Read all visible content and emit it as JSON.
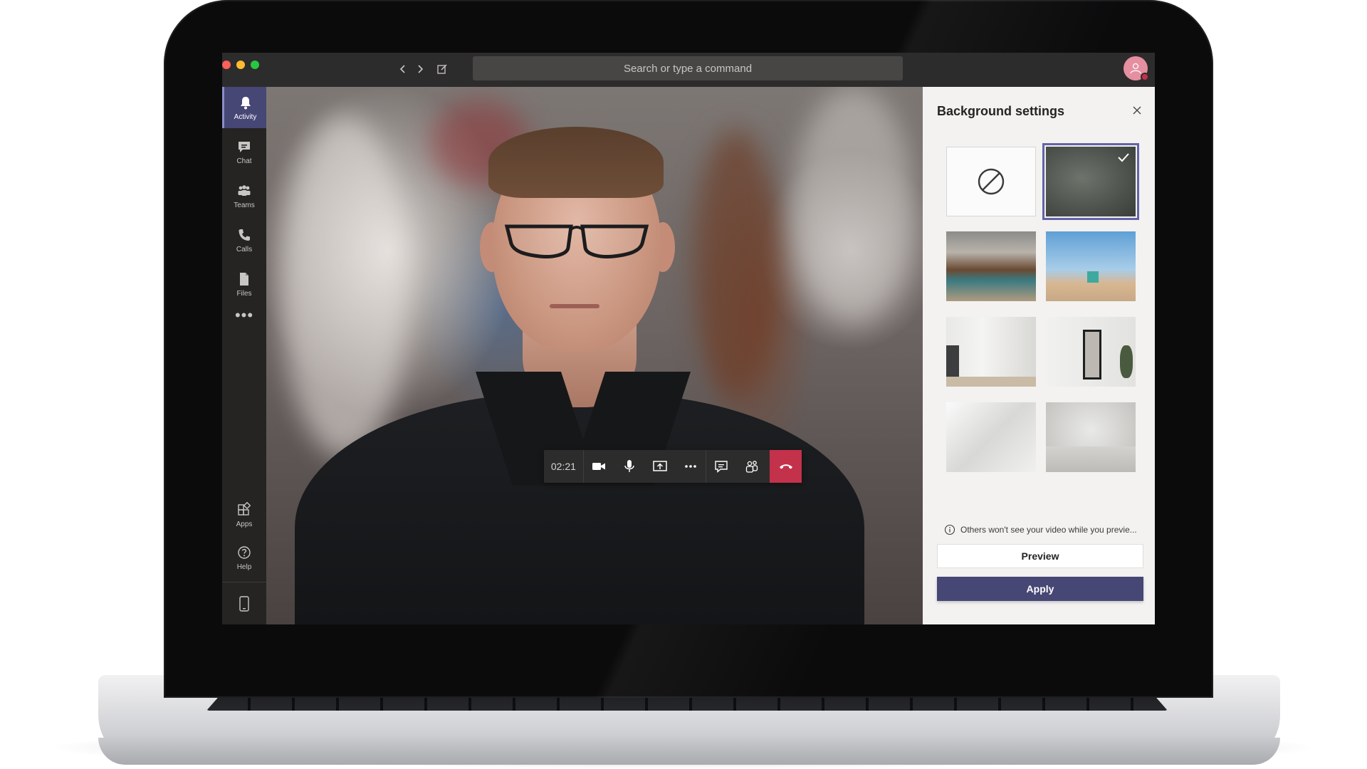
{
  "titlebar": {
    "search_placeholder": "Search or type a command"
  },
  "rail": {
    "items": [
      {
        "label": "Activity",
        "icon": "bell-icon",
        "active": true
      },
      {
        "label": "Chat",
        "icon": "chat-icon",
        "active": false
      },
      {
        "label": "Teams",
        "icon": "teams-icon",
        "active": false
      },
      {
        "label": "Calls",
        "icon": "phone-icon",
        "active": false
      },
      {
        "label": "Files",
        "icon": "file-icon",
        "active": false
      }
    ],
    "more": "•••",
    "bottom": [
      {
        "label": "Apps",
        "icon": "apps-icon"
      },
      {
        "label": "Help",
        "icon": "help-icon"
      }
    ]
  },
  "call": {
    "timer": "02:21",
    "controls": [
      "video-camera-icon",
      "microphone-icon",
      "share-screen-icon",
      "more-options-icon",
      "conversation-icon",
      "participants-icon",
      "hang-up-icon"
    ]
  },
  "panel": {
    "title": "Background settings",
    "info_text": "Others won't see your video while you previe...",
    "preview_label": "Preview",
    "apply_label": "Apply",
    "thumbnails": [
      {
        "name": "none",
        "selected": false
      },
      {
        "name": "blur",
        "selected": true
      },
      {
        "name": "office-loft",
        "selected": false
      },
      {
        "name": "beach-lifeguard-tower",
        "selected": false
      },
      {
        "name": "white-room-window",
        "selected": false
      },
      {
        "name": "white-room-mirror",
        "selected": false
      },
      {
        "name": "white-architecture",
        "selected": false
      },
      {
        "name": "white-empty-room",
        "selected": false
      }
    ]
  },
  "colors": {
    "accent": "#464775",
    "hangup": "#c4314b",
    "rail_active": "#464775",
    "app_bg": "#201f1f"
  }
}
